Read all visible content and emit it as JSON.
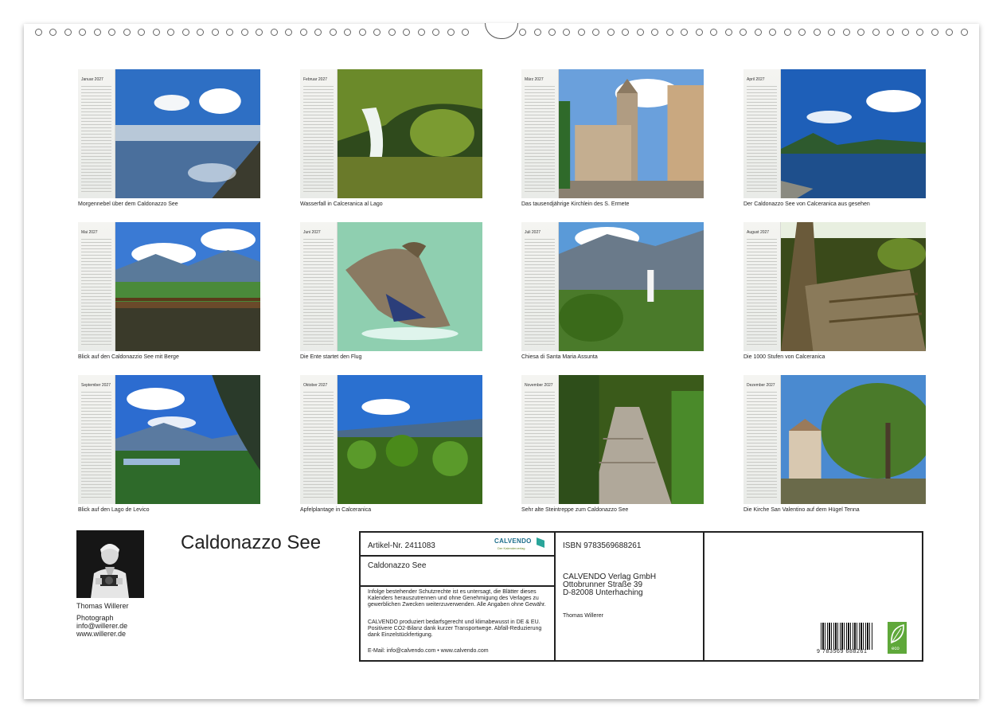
{
  "calendar": {
    "title": "Caldonazzo See",
    "months": [
      {
        "name": "Januar",
        "year": "2027",
        "caption": "Morgennebel über dem Caldonazzo See"
      },
      {
        "name": "Februar",
        "year": "2027",
        "caption": "Wasserfall in Calceranica al Lago"
      },
      {
        "name": "März",
        "year": "2027",
        "caption": "Das tausendjährige Kirchlein des S. Ermete"
      },
      {
        "name": "April",
        "year": "2027",
        "caption": "Der Caldonazzo See von Calceranica aus gesehen"
      },
      {
        "name": "Mai",
        "year": "2027",
        "caption": "Blick auf den Caldonazzio See mit Berge"
      },
      {
        "name": "Juni",
        "year": "2027",
        "caption": "Die Ente startet den Flug"
      },
      {
        "name": "Juli",
        "year": "2027",
        "caption": "Chiesa di Santa Maria Assunta"
      },
      {
        "name": "August",
        "year": "2027",
        "caption": "Die 1000 Stufen von Calceranica"
      },
      {
        "name": "September",
        "year": "2027",
        "caption": "Blick auf den Lago de Levico"
      },
      {
        "name": "Oktober",
        "year": "2027",
        "caption": "Apfelplantage in Calceranica"
      },
      {
        "name": "November",
        "year": "2027",
        "caption": "Sehr alte Steintreppe zum Caldonazzo See"
      },
      {
        "name": "Dezember",
        "year": "2027",
        "caption": "Die Kirche San Valentino auf dem Hügel Tenna"
      }
    ]
  },
  "author": {
    "name": "Thomas Willerer",
    "role": "Photograph",
    "email": "info@willerer.de",
    "web": "www.willerer.de"
  },
  "info": {
    "article": "Artikel-Nr. 2411083",
    "brand": "CALVENDO",
    "brand_sub": "Der Kalenderverlag",
    "title": "Caldonazzo See",
    "legal1": "Infolge bestehender Schutzrechte ist es untersagt, die Blätter dieses Kalenders herauszutrennen und ohne Genehmigung des Verlages zu gewerblichen Zwecken weiterzuverwenden. Alle Angaben ohne Gewähr.",
    "legal2": "CALVENDO produziert bedarfsgerecht und klimabewusst in DE & EU. Positivere CO2-Bilanz dank kurzer Transportwege. Abfall-Reduzierung dank Einzelstückfertigung.",
    "contact": "E-Mail: info@calvendo.com • www.calvendo.com",
    "isbn": "ISBN 9783569688261",
    "publisher1": "CALVENDO Verlag GmbH",
    "publisher2": "Ottobrunner Straße 39",
    "publisher3": "D-82008 Unterhaching",
    "author": "Thomas Willerer",
    "barcode": "9 783569 688261",
    "eco": "eco"
  }
}
